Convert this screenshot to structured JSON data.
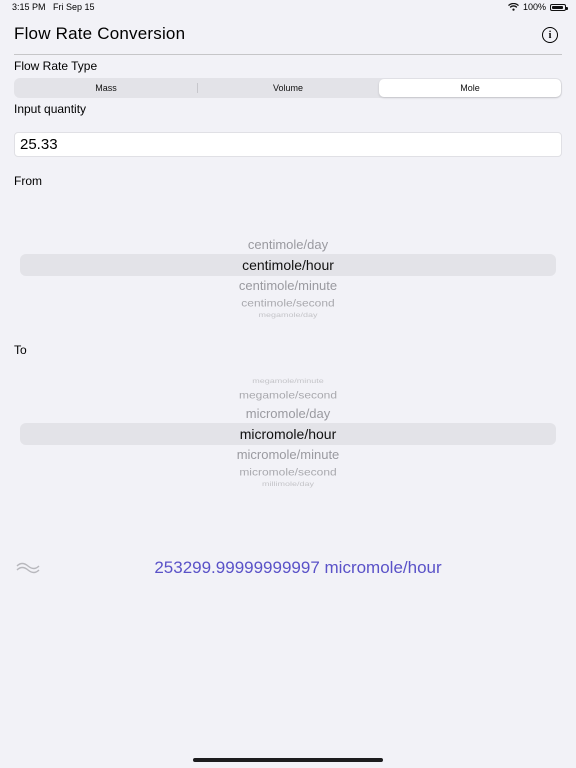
{
  "status": {
    "time": "3:15 PM",
    "date": "Fri Sep 15",
    "battery": "100%"
  },
  "header": {
    "title": "Flow Rate Conversion",
    "info_glyph": "i"
  },
  "flow_type": {
    "label": "Flow Rate Type",
    "options": [
      "Mass",
      "Volume",
      "Mole"
    ],
    "selected": "Mole"
  },
  "input": {
    "label": "Input quantity",
    "value": "25.33"
  },
  "from": {
    "label": "From",
    "items": [
      "centimole/day",
      "centimole/hour",
      "centimole/minute",
      "centimole/second",
      "megamole/day"
    ],
    "selected_index": 1
  },
  "to": {
    "label": "To",
    "items": [
      "megamole/minute",
      "megamole/second",
      "micromole/day",
      "micromole/hour",
      "micromole/minute",
      "micromole/second",
      "millimole/day"
    ],
    "selected_index": 3
  },
  "result": {
    "text": "253299.99999999997 micromole/hour",
    "icon": "approx-icon"
  }
}
